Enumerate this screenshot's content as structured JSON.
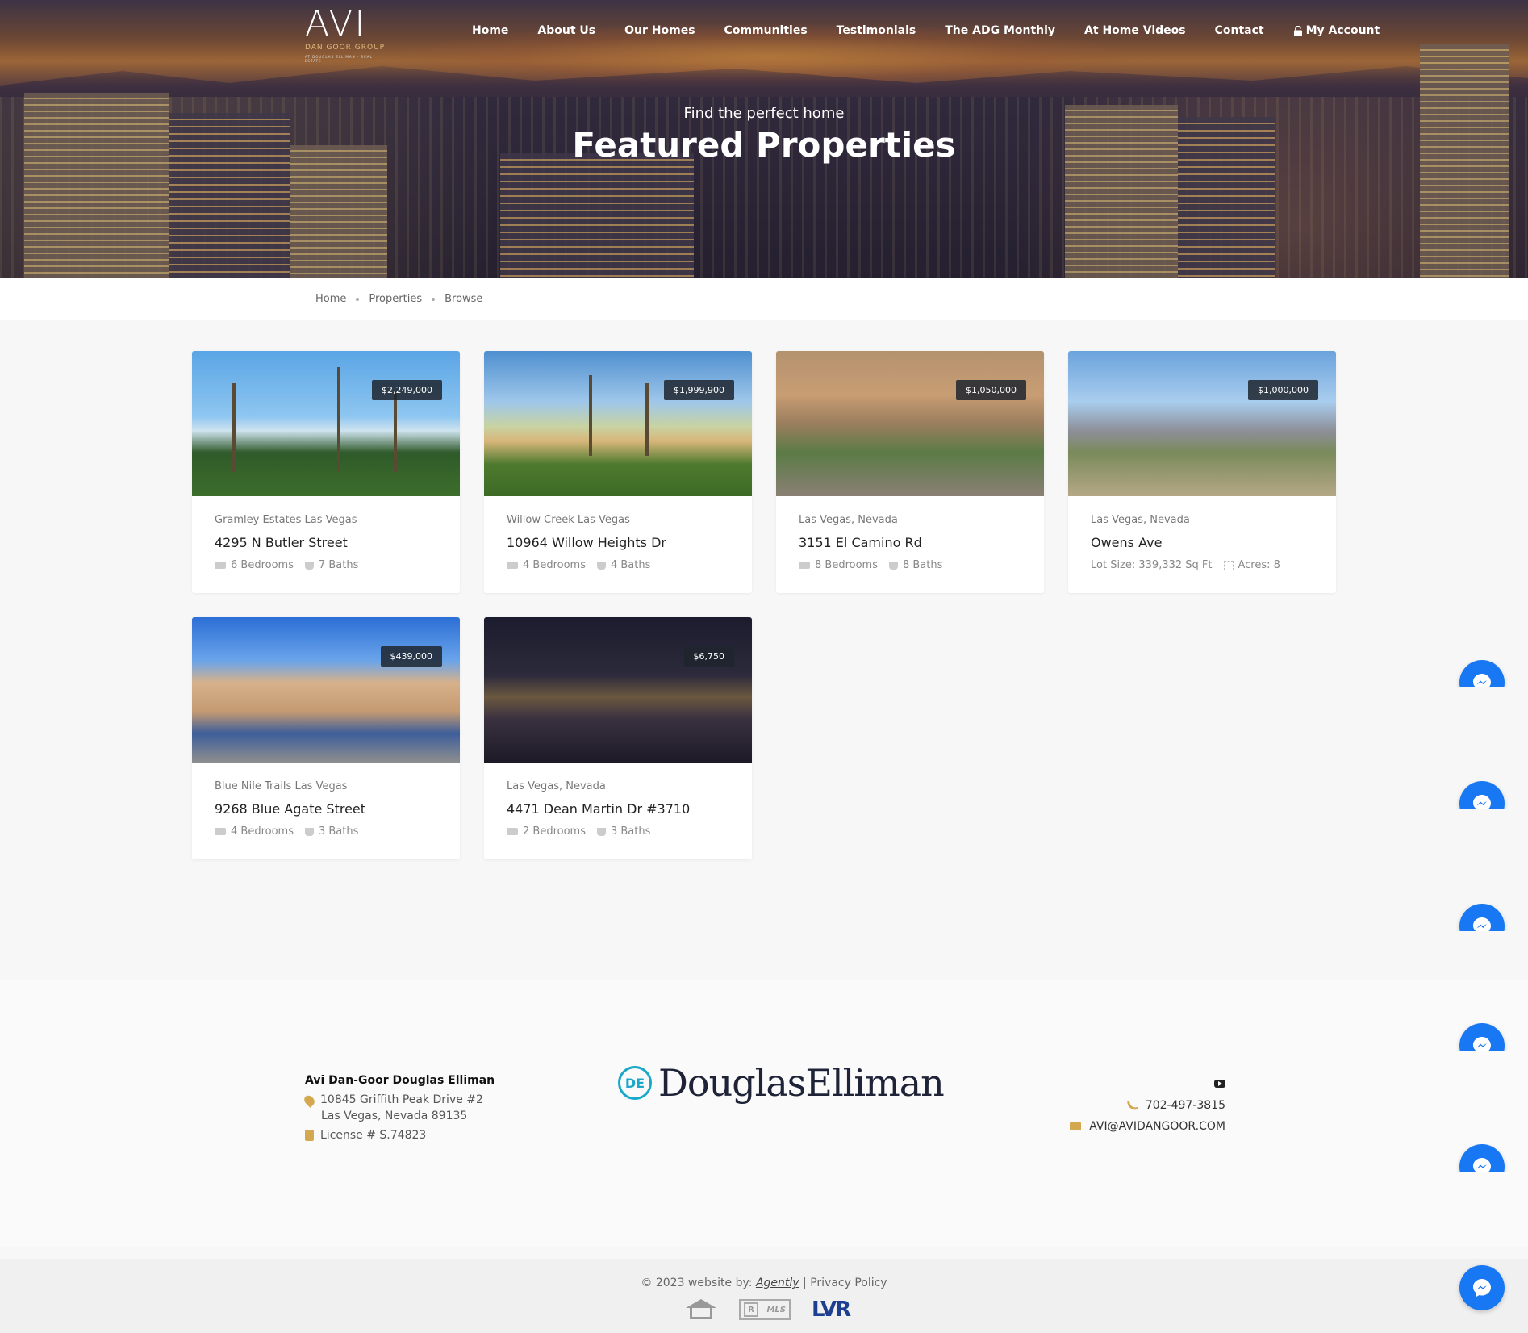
{
  "header": {
    "logo_mark": "AVI",
    "logo_sub": "DAN GOOR GROUP",
    "logo_fine": "AT DOUGLAS ELLIMAN · REAL ESTATE",
    "nav": [
      "Home",
      "About Us",
      "Our Homes",
      "Communities",
      "Testimonials",
      "The ADG Monthly",
      "At Home Videos",
      "Contact"
    ],
    "account_label": "My Account",
    "account_icon": "lock-icon"
  },
  "hero": {
    "subtitle": "Find the perfect home",
    "title": "Featured Properties"
  },
  "breadcrumb": [
    "Home",
    "Properties",
    "Browse"
  ],
  "listings": [
    {
      "price": "$2,249,000",
      "area": "Gramley Estates Las Vegas",
      "street": "4295 N Butler Street",
      "spec1": "6 Bedrooms",
      "spec2": "7 Baths",
      "spec1_icon": "bed-icon",
      "spec2_icon": "bath-icon"
    },
    {
      "price": "$1,999,900",
      "area": "Willow Creek Las Vegas",
      "street": "10964 Willow Heights Dr",
      "spec1": "4 Bedrooms",
      "spec2": "4 Baths",
      "spec1_icon": "bed-icon",
      "spec2_icon": "bath-icon"
    },
    {
      "price": "$1,050,000",
      "area": "Las Vegas, Nevada",
      "street": "3151 El Camino Rd",
      "spec1": "8 Bedrooms",
      "spec2": "8 Baths",
      "spec1_icon": "bed-icon",
      "spec2_icon": "bath-icon"
    },
    {
      "price": "$1,000,000",
      "area": "Las Vegas, Nevada",
      "street": "Owens Ave",
      "spec1": "Lot Size: 339,332 Sq Ft",
      "spec2": "Acres: 8",
      "spec1_icon": "none",
      "spec2_icon": "lot-icon"
    },
    {
      "price": "$439,000",
      "area": "Blue Nile Trails Las Vegas",
      "street": "9268 Blue Agate Street",
      "spec1": "4 Bedrooms",
      "spec2": "3 Baths",
      "spec1_icon": "bed-icon",
      "spec2_icon": "bath-icon"
    },
    {
      "price": "$6,750",
      "area": "Las Vegas, Nevada",
      "street": "4471 Dean Martin Dr #3710",
      "spec1": "2 Bedrooms",
      "spec2": "3 Baths",
      "spec1_icon": "bed-icon",
      "spec2_icon": "bath-icon"
    }
  ],
  "footer": {
    "office_name": "Avi Dan-Goor Douglas Elliman",
    "address1": "10845 Griffith Peak Drive #2",
    "address2": "Las Vegas, Nevada 89135",
    "license": "License # S.74823",
    "brand": "DouglasElliman",
    "brand_mark": "DE",
    "phone": "702-497-3815",
    "email": "AVI@AVIDANGOOR.COM"
  },
  "bottom": {
    "copyright_prefix": "© 2023 website by:",
    "agency": "Agently",
    "separator": "|",
    "privacy": "Privacy Policy",
    "mls_mark": "R",
    "mls_label": "MLS",
    "lvr_label": "LVR"
  },
  "colors": {
    "accent_gold": "#d4a84e",
    "messenger_blue": "#1877f2",
    "de_teal": "#1aa8c9"
  }
}
